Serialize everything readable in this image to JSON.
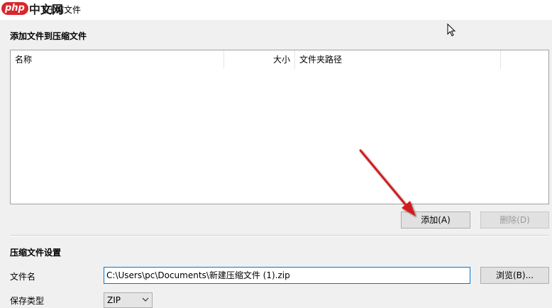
{
  "window": {
    "title_visible": "新建压缩文件",
    "logo_brand": "php",
    "logo_cn": "中文网"
  },
  "add_section": {
    "title": "添加文件到压缩文件",
    "columns": [
      "名称",
      "大小",
      "文件夹路径"
    ],
    "add_button": "添加(A)",
    "delete_button": "删除(D)"
  },
  "settings": {
    "title": "压缩文件设置",
    "filename_label": "文件名",
    "filename_value": "C:\\Users\\pc\\Documents\\新建压缩文件 (1).zip",
    "browse_button": "浏览(B)...",
    "type_label": "保存类型",
    "type_value": "ZIP"
  },
  "annotation": {
    "arrow_color": "#d21f1f"
  }
}
